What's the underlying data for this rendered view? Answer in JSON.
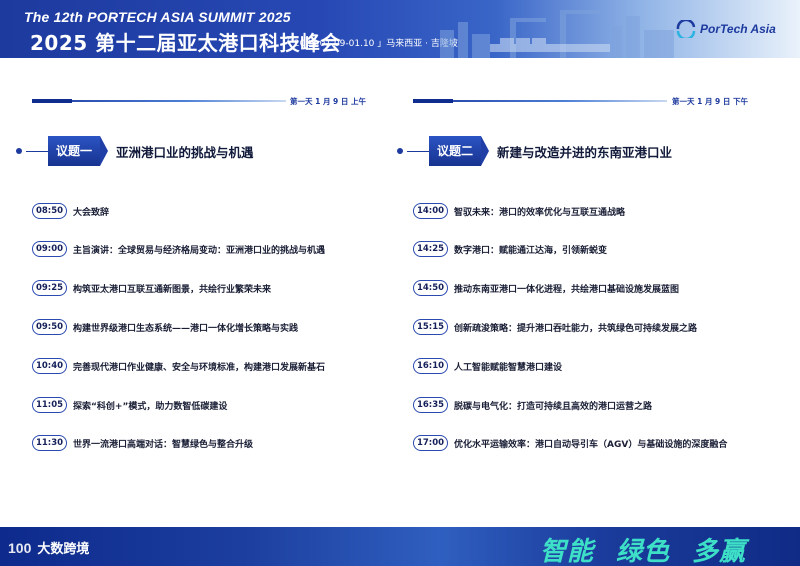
{
  "header": {
    "title_en": "The 12th PORTECH ASIA SUMMIT 2025",
    "title_cn": "2025 第十二届亚太港口科技峰会",
    "date_location": "「 2025.01.09-01.10 」马来西亚 · 吉隆坡",
    "logo_text": "PorTech Asia"
  },
  "left": {
    "day_label": "第一天 1 月 9 日  上午",
    "session_tag": "议题一",
    "session_title": "亚洲港口业的挑战与机遇",
    "items": [
      {
        "time": "08:50",
        "text": "大会致辞"
      },
      {
        "time": "09:00",
        "text": "主旨演讲：全球贸易与经济格局变动：亚洲港口业的挑战与机遇"
      },
      {
        "time": "09:25",
        "text": "构筑亚太港口互联互通新图景，共绘行业繁荣未来"
      },
      {
        "time": "09:50",
        "text": "构建世界级港口生态系统——港口一体化增长策略与实践"
      },
      {
        "time": "10:40",
        "text": "完善现代港口作业健康、安全与环境标准，构建港口发展新基石"
      },
      {
        "time": "11:05",
        "text": "探索“科创+”模式，助力数智低碳建设"
      },
      {
        "time": "11:30",
        "text": "世界一流港口高端对话：智慧绿色与整合升级"
      }
    ]
  },
  "right": {
    "day_label": "第一天 1 月 9 日  下午",
    "session_tag": "议题二",
    "session_title": "新建与改造并进的东南亚港口业",
    "items": [
      {
        "time": "14:00",
        "text": "智驭未来：港口的效率优化与互联互通战略"
      },
      {
        "time": "14:25",
        "text": "数字港口：赋能通江达海，引领新蜕变"
      },
      {
        "time": "14:50",
        "text": "推动东南亚港口一体化进程，共绘港口基础设施发展蓝图"
      },
      {
        "time": "15:15",
        "text": "创新疏浚策略：提升港口吞吐能力，共筑绿色可持续发展之路"
      },
      {
        "time": "16:10",
        "text": "人工智能赋能智慧港口建设"
      },
      {
        "time": "16:35",
        "text": "脱碳与电气化：打造可持续且高效的港口运营之路"
      },
      {
        "time": "17:00",
        "text": "优化水平运输效率：港口自动导引车（AGV）与基础设施的深度融合"
      }
    ]
  },
  "footer": {
    "brand_mark": "100",
    "brand_text": "大数跨境",
    "slogan": [
      "智能",
      "绿色",
      "多赢"
    ]
  },
  "colors": {
    "primary": "#1d3a9e",
    "accent": "#3de0c7"
  }
}
